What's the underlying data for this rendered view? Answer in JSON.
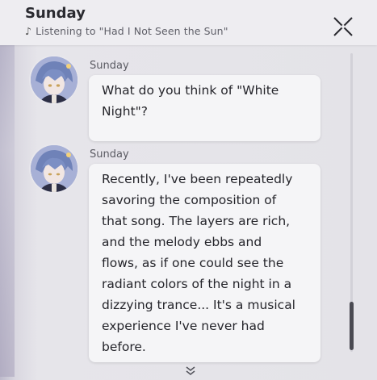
{
  "header": {
    "title": "Sunday",
    "note_glyph": "♪",
    "subtitle": "Listening to \"Had I Not Seen the Sun\""
  },
  "messages": [
    {
      "sender": "Sunday",
      "text": "What do you think of \"White\nNight\"?"
    },
    {
      "sender": "Sunday",
      "text": "Recently, I've been repeatedly\nsavoring the composition of\nthat song. The layers are rich,\nand the melody ebbs and\nflows, as if one could see the\nradiant colors of the night in a\ndizzying trance... It's a musical\nexperience I've never had\nbefore."
    }
  ],
  "icons": {
    "close": "close-icon",
    "more": "chevron-double-down-icon",
    "avatar": "sunday-avatar"
  },
  "colors": {
    "bubble": "#f5f5f7",
    "text": "#25252b",
    "scroll_thumb": "#4a4a52"
  }
}
